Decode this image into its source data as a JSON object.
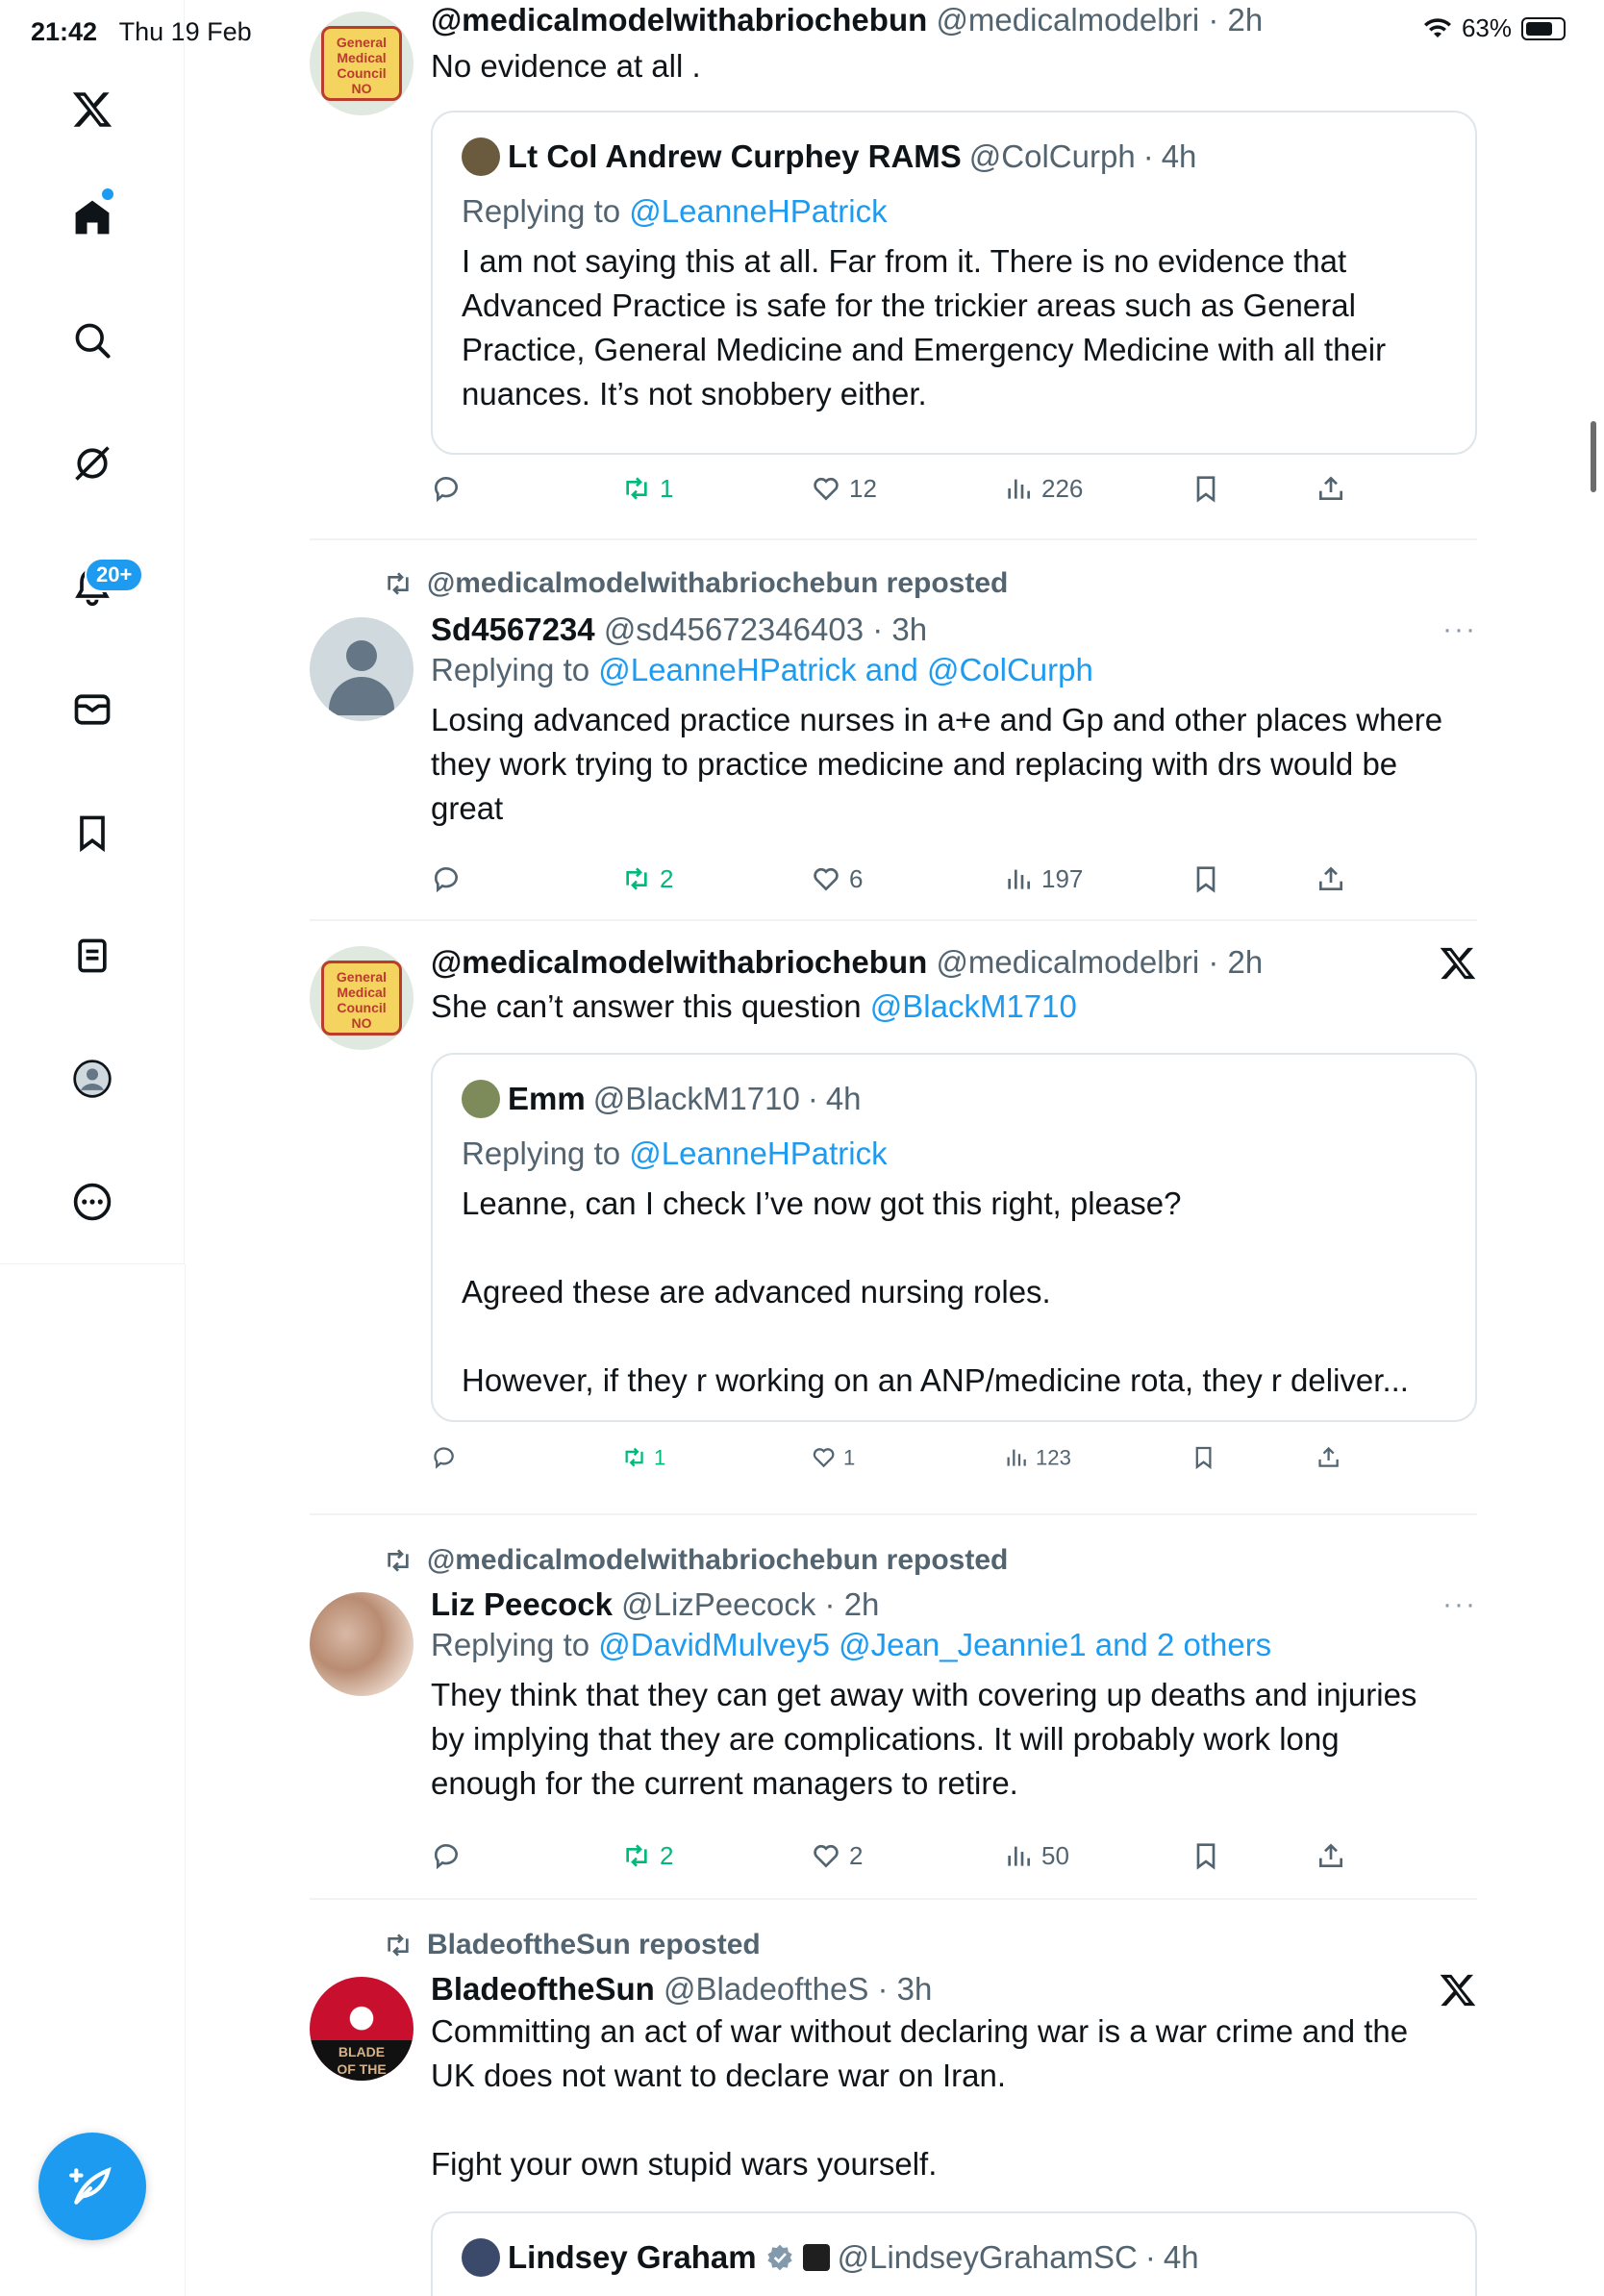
{
  "status_bar": {
    "time": "21:42",
    "date": "Thu 19 Feb",
    "battery": "63%"
  },
  "sidebar": {
    "items": [
      {
        "name": "x-logo-icon"
      },
      {
        "name": "home-icon"
      },
      {
        "name": "search-icon"
      },
      {
        "name": "grok-icon"
      },
      {
        "name": "notifications-icon"
      },
      {
        "name": "messages-icon"
      },
      {
        "name": "bookmarks-icon"
      },
      {
        "name": "lists-icon"
      },
      {
        "name": "profile-icon"
      },
      {
        "name": "more-icon"
      }
    ],
    "notifications_badge": "20+"
  },
  "tweets": [
    {
      "display_name": "@medicalmodelwithabriochebun",
      "handle": "@medicalmodelbri",
      "time": "2h",
      "text": "No evidence at all .",
      "quote": {
        "display_name": "Lt Col Andrew Curphey RAMS",
        "handle": "@ColCurph",
        "time": "4h",
        "replying_prefix": "Replying to ",
        "replying_to": "@LeanneHPatrick",
        "lines": [
          "I am not saying this at all. Far from it. There is no evidence that",
          "Advanced Practice is safe for the trickier areas such as General",
          "Practice, General Medicine and Emergency Medicine with all their",
          "nuances. It’s not snobbery either."
        ]
      },
      "retweets": "1",
      "likes": "12",
      "views": "226"
    },
    {
      "reposted_by": "@medicalmodelwithabriochebun reposted",
      "display_name": "Sd4567234",
      "handle": "@sd45672346403",
      "time": "3h",
      "replying_prefix": "Replying to ",
      "replying_to": "@LeanneHPatrick and @ColCurph",
      "lines": [
        "Losing advanced practice nurses in a+e and Gp and other places where",
        "they work  trying to practice medicine and replacing with drs would be",
        "great"
      ],
      "retweets": "2",
      "likes": "6",
      "views": "197"
    },
    {
      "display_name": "@medicalmodelwithabriochebun",
      "handle": "@medicalmodelbri",
      "time": "2h",
      "text": "She can’t answer this question ",
      "text_mention": "@BlackM1710",
      "quote": {
        "display_name": "Emm",
        "handle": "@BlackM1710",
        "time": "4h",
        "replying_prefix": "Replying to ",
        "replying_to": "@LeanneHPatrick",
        "line1": "Leanne, can I check I’ve now got this right, please?",
        "line2": "Agreed these are advanced nursing roles.",
        "line3": "However, if they r working on an ANP/medicine rota, they r deliver..."
      },
      "retweets": "1",
      "likes": "1",
      "views": "123"
    },
    {
      "reposted_by": "@medicalmodelwithabriochebun reposted",
      "display_name": "Liz Peecock",
      "handle": "@LizPeecock",
      "time": "2h",
      "replying_prefix": "Replying to ",
      "replying_to": "@DavidMulvey5 @Jean_Jeannie1 and 2 others",
      "lines": [
        "They think that they can get away with covering up deaths and injuries",
        "by implying that they are complications.  It will probably work long",
        "enough for the current managers to retire."
      ],
      "retweets": "2",
      "likes": "2",
      "views": "50"
    },
    {
      "reposted_by": "BladeoftheSun reposted",
      "display_name": "BladeoftheSun",
      "handle": "@BladeoftheS",
      "time": "3h",
      "lines": [
        "Committing an act of war without declaring war is a war crime and the",
        "UK does not want to declare war on Iran."
      ],
      "line_extra": "Fight your own stupid wars yourself.",
      "quote": {
        "display_name": "Lindsey Graham",
        "handle": "@LindseyGrahamSC",
        "time": "4h"
      }
    }
  ],
  "avatar_text": {
    "gmc_1": "General",
    "gmc_2": "Medical",
    "gmc_3": "Council",
    "gmc_4": "NO",
    "blade_1": "BLADE",
    "blade_2": "OF THE"
  },
  "separator": " · ",
  "colors": {
    "accent": "#1d9bf0",
    "retweet": "#00ba7c",
    "muted": "#536471"
  }
}
